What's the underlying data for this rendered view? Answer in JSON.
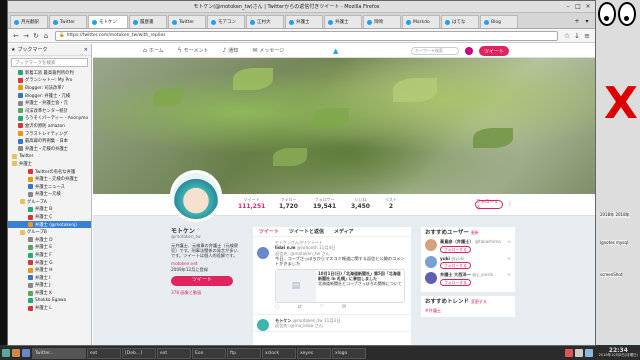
{
  "window": {
    "title": "モトケン(@motoken_tw)さん | Twitterからの返信付きツイート - Mozilla Firefox"
  },
  "tabs": [
    {
      "label": "月光翻訳"
    },
    {
      "label": "Twitter"
    },
    {
      "label": "モトケン"
    },
    {
      "label": "履歴書"
    },
    {
      "label": "Twitter"
    },
    {
      "label": "モアコン"
    },
    {
      "label": "江村大"
    },
    {
      "label": "弁護士"
    },
    {
      "label": "弁護士"
    },
    {
      "label": "岡崎"
    },
    {
      "label": "Markdo"
    },
    {
      "label": "はてな"
    },
    {
      "label": "Blog"
    }
  ],
  "url": "https://twitter.com/motoken_tw/with_replies",
  "sidebar": {
    "title": "ブックマーク",
    "search_placeholder": "ブックマークを検索",
    "items": [
      {
        "label": "新着工房 最高裁判所の判"
      },
      {
        "label": "グランシャトー: My Pro"
      },
      {
        "label": "Blogger: 司法改革?"
      },
      {
        "label": "Blogger: 弁護士・元検"
      },
      {
        "label": "弁護士・弁護士会・元"
      },
      {
        "label": "司法改革センター統計"
      },
      {
        "label": "ろうそくパーティー - Anonymo"
      },
      {
        "label": "倉沢の原則 amazon"
      },
      {
        "label": "フラストレイティング"
      },
      {
        "label": "最高裁の判例集 - 日本"
      },
      {
        "label": "弁護士・元検の弁護士"
      },
      {
        "label": "Twitter"
      },
      {
        "label": "弁護士"
      },
      {
        "label": "Twitterの有名な弁護"
      },
      {
        "label": "弁護士・元検の弁護士"
      },
      {
        "label": "弁護士ニュース"
      },
      {
        "label": "弁護士ー元検"
      },
      {
        "label": "グループA"
      },
      {
        "label": "弁護士 B"
      },
      {
        "label": "弁護士 C"
      },
      {
        "label": "弁護士 (@motokenj)"
      },
      {
        "label": "グループB"
      },
      {
        "label": "弁護士 D"
      },
      {
        "label": "弁護士 E"
      },
      {
        "label": "弁護士 F"
      },
      {
        "label": "弁護士 G"
      },
      {
        "label": "弁護士 H"
      },
      {
        "label": "弁護士 I"
      },
      {
        "label": "弁護士 J"
      },
      {
        "label": "弁護士 K"
      },
      {
        "label": "Shokko Egawa"
      },
      {
        "label": "弁護士 L"
      }
    ]
  },
  "twitter_nav": {
    "home": "ホーム",
    "moments": "モーメント",
    "notifications": "通知",
    "messages": "メッセージ",
    "search_placeholder": "キーワード検索",
    "tweet_button": "ツイート"
  },
  "stats": [
    {
      "label": "ツイート",
      "value": "111,251"
    },
    {
      "label": "フォロー",
      "value": "1,720"
    },
    {
      "label": "フォロワー",
      "value": "19,541"
    },
    {
      "label": "いいね",
      "value": "3,450"
    },
    {
      "label": "リスト",
      "value": "2"
    }
  ],
  "follow_button": "フォローする",
  "profile": {
    "name": "モトケン",
    "handle": "@motoken_tw",
    "bio": "元弁護士、元検事の弁護士（元検察官）です。刑事法関係の発言が多いです。ツイートは個人的見解です。",
    "location": "motoken.net",
    "joined": "2009年12月に登録",
    "tweet_button": "ツイート",
    "media_link": "378 画像と動画"
  },
  "timeline": {
    "tabs": [
      "ツイート",
      "ツイートと返信",
      "メディア"
    ],
    "tweets": [
      {
        "retweet": "モトケンさんがリツイート",
        "name": "lidai n.m",
        "handle": "@iwaooth",
        "date": "11月4日",
        "reply": "返信先: @motoken_tw さん",
        "text": "今日、コープさっぽろからマスコミ報道に関する返信と公開のコメントがきました",
        "card_text": "10月1日(日)「北海道新聞社」第5回「北海道新聞社 in 札幌」に参加しました",
        "card_sub": "北海道新聞社とコープさっぽろの関係について"
      },
      {
        "name": "モトケン",
        "handle": "@motoken_tw",
        "date": "11月3日",
        "reply": "返信先: @mo_koba さん"
      }
    ]
  },
  "right": {
    "follow_title": "おすすめユーザー",
    "follow_sub": "更新",
    "users": [
      {
        "name": "高島彦（弁護士）",
        "handle": "@takashima"
      },
      {
        "name": "yuki",
        "handle": "@yuki"
      },
      {
        "name": "弁護士 大西洋一",
        "handle": "@y_onishi"
      }
    ],
    "follow_label": "フォローする",
    "trends_title": "おすすめトレンド",
    "trends_sub": "変更する",
    "trend": "#弁護士"
  },
  "taskbar": {
    "tasks": [
      "Twitter...",
      "ext",
      "[Deb...]",
      "ext",
      "Eon",
      "ftp",
      "xclock",
      "xeyes",
      "xlogo"
    ],
    "time": "22:34",
    "date": "2018年10月8日(月曜日)"
  },
  "widgets": {
    "a": "2018年 2018年",
    "b": "lgnotes mysql",
    "c": "screenShot"
  },
  "colors": {
    "accent": "#e0245e",
    "twitter_blue": "#1da1f2",
    "selected": "#3a7fd0"
  }
}
